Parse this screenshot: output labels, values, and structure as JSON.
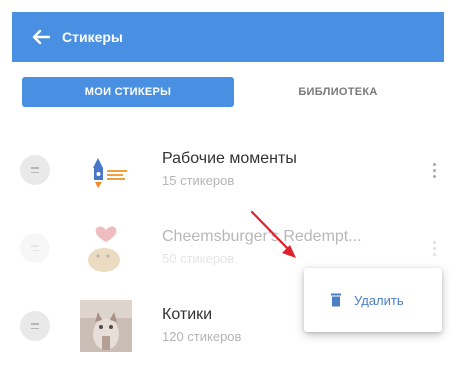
{
  "appbar": {
    "title": "Стикеры",
    "back_icon": "arrow-left-icon"
  },
  "tabs": [
    {
      "label": "МОИ СТИКЕРЫ",
      "active": true
    },
    {
      "label": "БИБЛИОТЕКА",
      "active": false
    }
  ],
  "packs": [
    {
      "title": "Рабочие моменты",
      "subtitle": "15 стикеров"
    },
    {
      "title": "Cheemsburger's Redempt...",
      "subtitle": "50 стикеров"
    },
    {
      "title": "Котики",
      "subtitle": "120 стикеров"
    }
  ],
  "context_menu": {
    "delete_label": "Удалить",
    "delete_icon": "trash-icon"
  },
  "colors": {
    "accent": "#4a90e2",
    "annotation_arrow": "#e0202a"
  }
}
